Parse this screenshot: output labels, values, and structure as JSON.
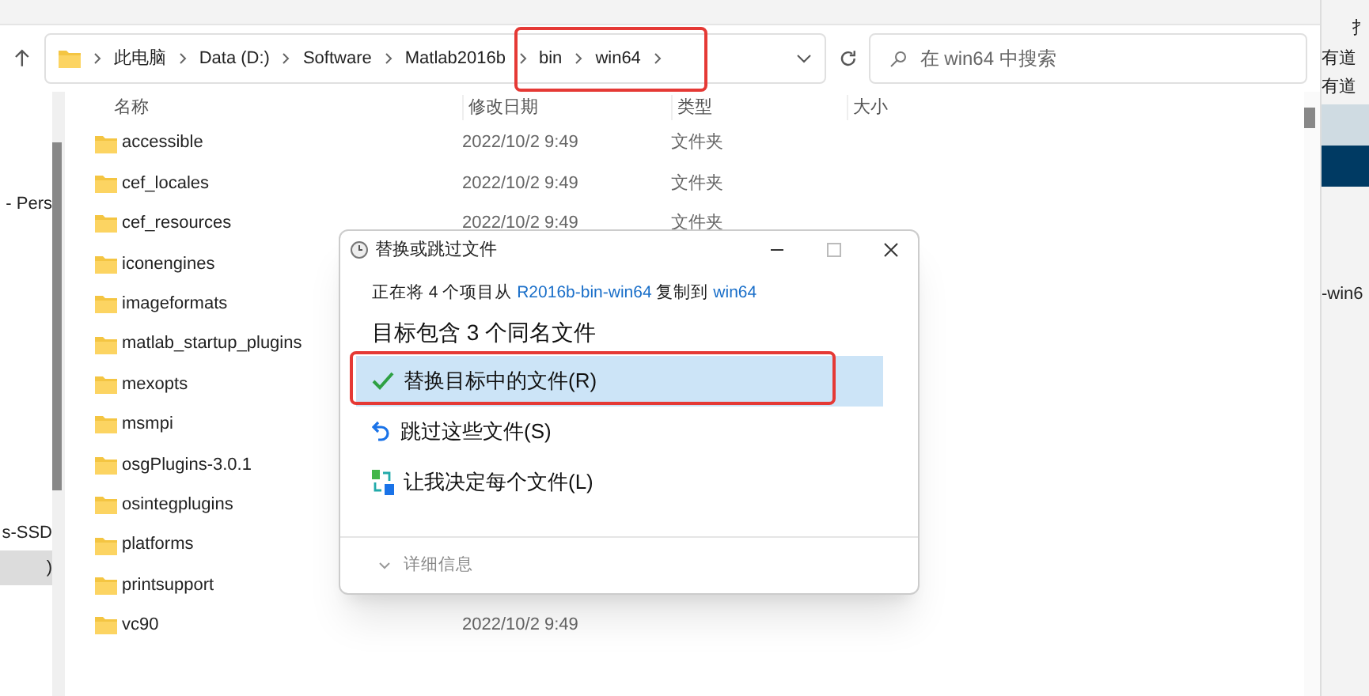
{
  "breadcrumb": [
    "此电脑",
    "Data (D:)",
    "Software",
    "Matlab2016b",
    "bin",
    "win64"
  ],
  "search": {
    "placeholder": "在 win64 中搜索"
  },
  "sidebar": {
    "items": [
      {
        "label": "- Pers",
        "selected": false
      },
      {
        "label": "s-SSD",
        "selected": false
      },
      {
        "label": ")",
        "selected": true
      }
    ]
  },
  "table": {
    "columns": [
      "名称",
      "修改日期",
      "类型",
      "大小"
    ],
    "rows": [
      {
        "name": "accessible",
        "date": "2022/10/2 9:49",
        "type": "文件夹"
      },
      {
        "name": "cef_locales",
        "date": "2022/10/2 9:49",
        "type": "文件夹"
      },
      {
        "name": "cef_resources",
        "date": "2022/10/2 9:49",
        "type": "文件夹"
      },
      {
        "name": "iconengines"
      },
      {
        "name": "imageformats"
      },
      {
        "name": "matlab_startup_plugins"
      },
      {
        "name": "mexopts"
      },
      {
        "name": "msmpi"
      },
      {
        "name": "osgPlugins-3.0.1"
      },
      {
        "name": "osintegplugins"
      },
      {
        "name": "platforms"
      },
      {
        "name": "printsupport"
      },
      {
        "name": "vc90",
        "date": "2022/10/2 9:49"
      }
    ]
  },
  "right_window": {
    "texts": [
      "扌",
      "有道",
      "有道",
      "-win6"
    ]
  },
  "dialog": {
    "title": "替换或跳过文件",
    "message": [
      "正在将 4 个项目从 ",
      "R2016b-bin-win64",
      " 复制到 ",
      "win64"
    ],
    "heading": "目标包含 3 个同名文件",
    "options": [
      {
        "kind": "replace",
        "label": "替换目标中的文件(R)",
        "selected": true
      },
      {
        "kind": "skip",
        "label": "跳过这些文件(S)",
        "selected": false
      },
      {
        "kind": "decide",
        "label": "让我决定每个文件(L)",
        "selected": false
      }
    ],
    "details": "详细信息"
  }
}
